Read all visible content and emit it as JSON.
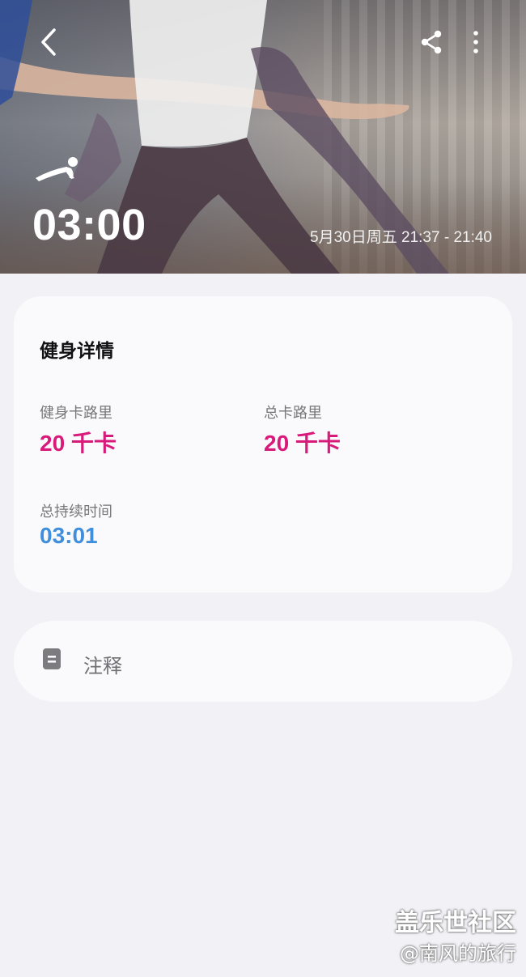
{
  "header": {
    "duration": "03:00",
    "date_range": "5月30日周五 21:37 - 21:40",
    "back_icon": "back-arrow-icon",
    "share_icon": "share-icon",
    "more_icon": "more-vertical-icon",
    "workout_icon": "plank-workout-icon"
  },
  "details": {
    "title": "健身详情",
    "workout_calories_label": "健身卡路里",
    "workout_calories_value": "20 千卡",
    "total_calories_label": "总卡路里",
    "total_calories_value": "20 千卡",
    "total_duration_label": "总持续时间",
    "total_duration_value": "03:01"
  },
  "notes": {
    "label": "注释",
    "icon": "note-icon"
  },
  "watermark": {
    "title": "盖乐世社区",
    "author": "@南风的旅行"
  },
  "colors": {
    "calorie_value": "#d81b7a",
    "duration_value": "#3f8fdd",
    "background": "#f1f1f6",
    "card": "#fafafd"
  }
}
